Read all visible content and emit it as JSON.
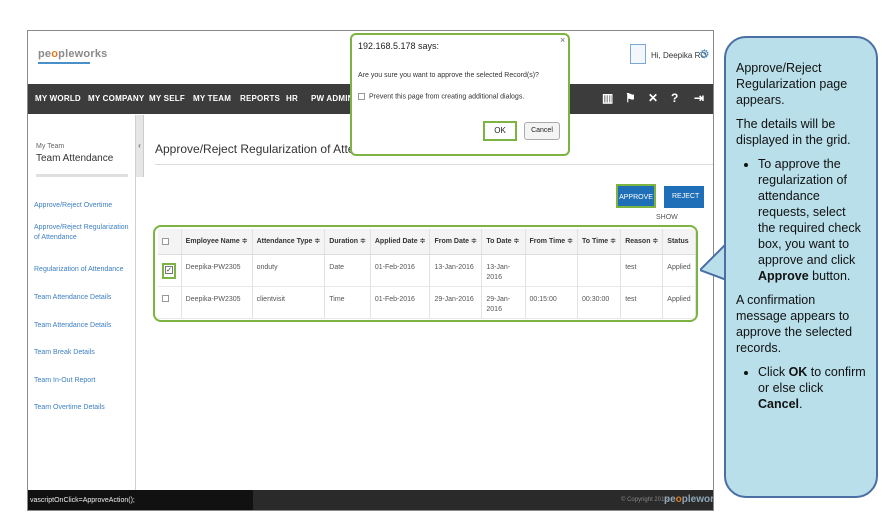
{
  "header": {
    "logo_text_pre": "pe",
    "logo_text_o": "o",
    "logo_text_post": "pleworks",
    "greeting": "Hi, Deepika RO"
  },
  "nav": {
    "items": [
      "MY WORLD",
      "MY COMPANY",
      "MY SELF",
      "MY TEAM",
      "REPORTS",
      "HR",
      "PW ADMIN"
    ],
    "icons": [
      "book-icon",
      "flag-icon",
      "tools-icon",
      "help-icon",
      "logout-icon"
    ]
  },
  "sidebar": {
    "section_small": "My Team",
    "section_title": "Team Attendance",
    "links": [
      "Approve/Reject Overtime",
      "Approve/Reject Regularization of Attendance",
      "Regularization of Attendance",
      "Team Attendance Details",
      "Team Attendance Details",
      "Team Break Details",
      "Team In-Out Report",
      "Team Overtime Details"
    ]
  },
  "main": {
    "page_title": "Approve/Reject Regularization of Attendance",
    "approve_label": "APPROVE",
    "reject_label": "REJECT",
    "show_label": "SHOW"
  },
  "grid": {
    "columns": [
      "",
      "Employee Name ≑",
      "Attendance Type ≑",
      "Duration ≑",
      "Applied Date ≑",
      "From Date ≑",
      "To Date ≑",
      "From Time ≑",
      "To Time ≑",
      "Reason ≑",
      "Status"
    ],
    "rows": [
      {
        "checked": true,
        "employee": "Deepika-PW2305",
        "type": "onduty",
        "duration": "Date",
        "applied": "01-Feb-2016",
        "from_date": "13-Jan-2016",
        "to_date": "13-Jan-2016",
        "from_time": "",
        "to_time": "",
        "reason": "test",
        "status": "Applied"
      },
      {
        "checked": false,
        "employee": "Deepika-PW2305",
        "type": "clientvisit",
        "duration": "Time",
        "applied": "01-Feb-2016",
        "from_date": "29-Jan-2016",
        "to_date": "29-Jan-2016",
        "from_time": "00:15:00",
        "to_time": "00:30:00",
        "reason": "test",
        "status": "Applied"
      }
    ]
  },
  "dialog": {
    "title": "192.168.5.178 says:",
    "close": "×",
    "message": "Are you sure you want to approve the selected Record(s)?",
    "prevent_label": "Prevent this page from creating additional dialogs.",
    "ok_label": "OK",
    "cancel_label": "Cancel"
  },
  "footer": {
    "status_url": "vascriptOnClick=ApproveAction();",
    "copyright": "© Copyright 2016",
    "logo_pre": "pe",
    "logo_o": "o",
    "logo_post": "pleworks"
  },
  "callout": {
    "p1": "Approve/Reject Regularization page appears.",
    "p2": "The details will be displayed in the grid.",
    "b1_pre": "To approve the regularization of attendance requests, select the required check box, you want to approve and click ",
    "b1_bold": "Approve",
    "b1_post": " button.",
    "p3": "A confirmation message appears to approve the selected records.",
    "b2_pre": "Click ",
    "b2_ok": "OK",
    "b2_mid": " to confirm or else click ",
    "b2_cancel": "Cancel",
    "b2_post": "."
  },
  "colors": {
    "accent_green": "#7cb342",
    "button_blue": "#1f6fb8",
    "nav_dark": "#3c3c3c",
    "callout_fill": "#b9dfea",
    "link_blue": "#3d7fc1"
  }
}
